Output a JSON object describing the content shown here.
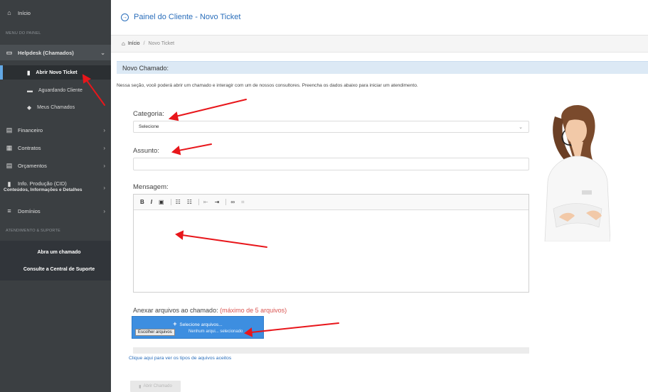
{
  "sidebar": {
    "home_label": "Início",
    "menu_header": "MENU DO PAINEL",
    "helpdesk_label": "Helpdesk (Chamados)",
    "helpdesk_items": [
      {
        "label": "Abrir Novo Ticket",
        "icon": "file-icon"
      },
      {
        "label": "Aguardando Cliente",
        "icon": "keyboard-icon"
      },
      {
        "label": "Meus Chamados",
        "icon": "tag-icon"
      }
    ],
    "items": [
      {
        "label": "Financeiro",
        "icon": "money-icon"
      },
      {
        "label": "Contratos",
        "icon": "document-icon"
      },
      {
        "label": "Orçamentos",
        "icon": "money-icon"
      },
      {
        "label": "Info. Produção (CID)",
        "sublabel": "Conteúdos, Informações e Detalhes",
        "icon": "book-icon"
      },
      {
        "label": "Domínios",
        "icon": "menu-icon"
      }
    ],
    "support_header": "ATENDIMENTO & SUPORTE",
    "support_links": [
      "Abra um chamado",
      "Consulte a Central de Suporte"
    ]
  },
  "header": {
    "title": "Painel do Cliente - Novo Ticket"
  },
  "breadcrumb": {
    "home": "Início",
    "separator": "/",
    "current": "Novo Ticket"
  },
  "section": {
    "title": "Novo Chamado:",
    "intro": "Nessa seção, você poderá abrir um chamado e interagir com um de nossos consultores. Preencha os dados abaixo para iniciar um atendimento."
  },
  "form": {
    "category_label": "Categoria:",
    "category_value": "Selecione",
    "subject_label": "Assunto:",
    "subject_value": "",
    "message_label": "Mensagem:",
    "toolbar": [
      "B",
      "I",
      "▣",
      "☷",
      "☷",
      "⇤",
      "⇥",
      "∞",
      "⌗"
    ],
    "attach_label": "Anexar arquivos ao chamado:",
    "attach_limit": "(máximo de 5 arquivos)",
    "upload_title": "Selecione arquivos...",
    "choose_button": "Escolher arquivos",
    "no_file": "Nenhum arqui... selecionado",
    "help_link": "Clique aqui para ver os tipos de aquivos aceitos",
    "submit_label": "Abrir Chamado"
  },
  "colors": {
    "sidebar_bg": "#3b3f42",
    "accent_blue": "#2a6ebb",
    "upload_blue": "#3d8ee0",
    "annotation_red": "#e8161b",
    "limit_red": "#d9534f"
  }
}
